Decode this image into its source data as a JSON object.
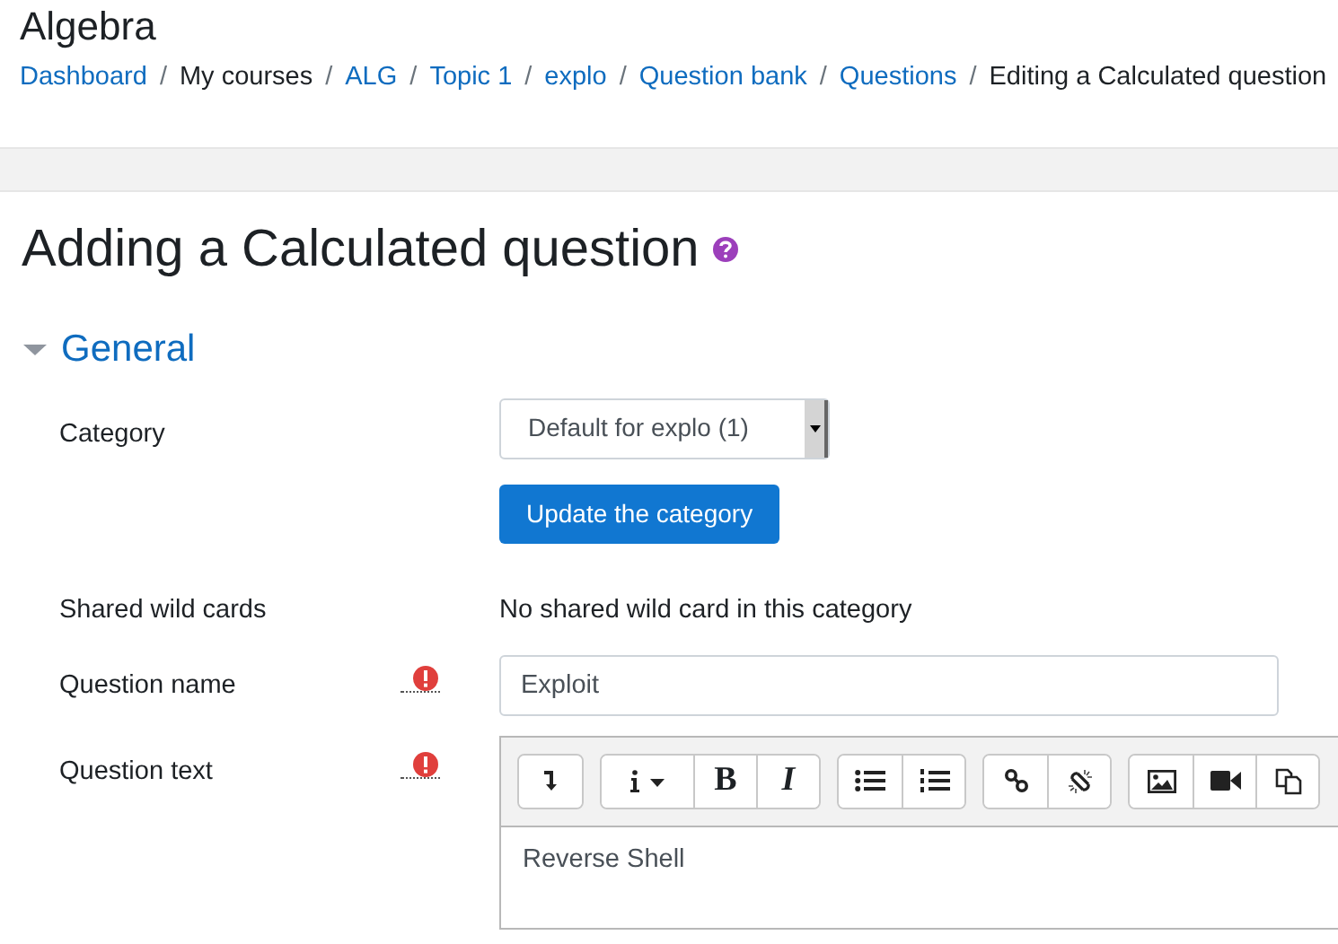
{
  "course_title": "Algebra",
  "breadcrumb_separator": "/",
  "breadcrumb": [
    {
      "label": "Dashboard",
      "kind": "link"
    },
    {
      "label": "My courses",
      "kind": "text"
    },
    {
      "label": "ALG",
      "kind": "link"
    },
    {
      "label": "Topic 1",
      "kind": "link"
    },
    {
      "label": "explo",
      "kind": "link"
    },
    {
      "label": "Question bank",
      "kind": "link"
    },
    {
      "label": "Questions",
      "kind": "link"
    },
    {
      "label": "Editing a Calculated question",
      "kind": "text"
    }
  ],
  "page_heading": "Adding a Calculated question",
  "section": {
    "title": "General",
    "expanded": true
  },
  "fields": [
    {
      "label": "Category",
      "kind": "select",
      "value": "Default for explo (1)",
      "button": "Update the category",
      "required": false
    },
    {
      "label": "Shared wild cards",
      "kind": "static",
      "value": "No shared wild card in this category",
      "required": false
    },
    {
      "label": "Question name",
      "kind": "text",
      "value": "Exploit",
      "required": true
    },
    {
      "label": "Question text",
      "kind": "editor",
      "value": "Reverse Shell",
      "required": true,
      "toolbar": [
        [
          {
            "kind": "collapse"
          }
        ],
        [
          {
            "kind": "info"
          },
          {
            "kind": "bold",
            "label": "B"
          },
          {
            "kind": "italic",
            "label": "I"
          }
        ],
        [
          {
            "kind": "bullets"
          },
          {
            "kind": "numbers"
          }
        ],
        [
          {
            "kind": "link"
          },
          {
            "kind": "unlink"
          }
        ],
        [
          {
            "kind": "image"
          },
          {
            "kind": "video"
          },
          {
            "kind": "media"
          }
        ]
      ]
    }
  ]
}
